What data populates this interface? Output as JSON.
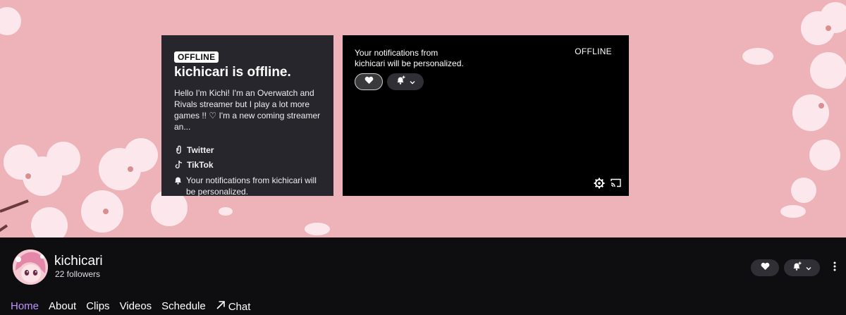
{
  "offline_card": {
    "badge": "OFFLINE",
    "title": "kichicari is offline.",
    "bio": "Hello I'm Kichi! I'm an Overwatch and Rivals streamer but I play a lot more games !! ♡ I'm a new coming streamer an...",
    "links": [
      {
        "label": "Twitter",
        "icon": "link-icon"
      },
      {
        "label": "TikTok",
        "icon": "tiktok-icon"
      }
    ],
    "notification_text": "Your notifications from kichicari will be personalized."
  },
  "player": {
    "notification_line1": "Your notifications from",
    "notification_line2": "kichicari will be personalized.",
    "status": "OFFLINE"
  },
  "channel": {
    "name": "kichicari",
    "followers": "22 followers"
  },
  "tabs": [
    {
      "label": "Home",
      "active": true
    },
    {
      "label": "About"
    },
    {
      "label": "Clips"
    },
    {
      "label": "Videos"
    },
    {
      "label": "Schedule"
    },
    {
      "label": "Chat",
      "icon": "arrow-up-right-icon"
    }
  ],
  "colors": {
    "accent": "#bf94ff",
    "banner": "#eeb3b9",
    "card": "#26262c",
    "background": "#0e0e10"
  }
}
